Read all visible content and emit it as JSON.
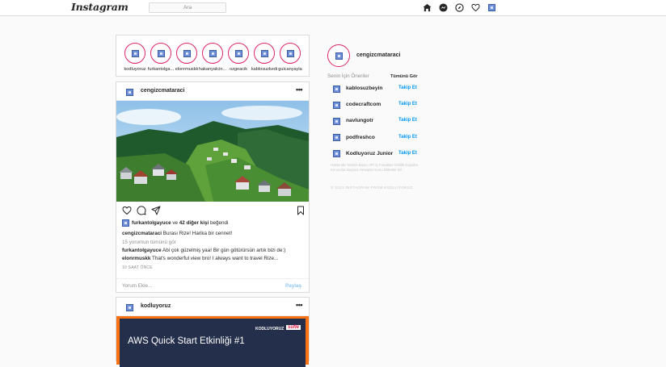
{
  "nav": {
    "logo": "Instagram",
    "search_placeholder": "Ara",
    "icons": [
      "home-icon",
      "messenger-icon",
      "explore-icon",
      "heart-icon",
      "profile-avatar"
    ]
  },
  "stories": [
    {
      "name": "kodluyoruz"
    },
    {
      "name": "furkantolga..."
    },
    {
      "name": "elonrmuskk"
    },
    {
      "name": "hakanyalcin..."
    },
    {
      "name": "ozgeacik"
    },
    {
      "name": "kablosuzkedi"
    },
    {
      "name": "guicanyayla"
    }
  ],
  "post": {
    "user": "cengizcmataraci",
    "more": "•••",
    "likes": {
      "first": "furkantolgayuce",
      "middle": " ve ",
      "others": "42 diğer kişi",
      "suffix": " beğendi"
    },
    "caption": {
      "user": "cengizcmataraci",
      "text": " Burası Rize! Harika bir cennet!"
    },
    "view_all": "15 yorumun tümünü gör",
    "comments": [
      {
        "user": "furkantolgayuce",
        "text": " Abi çok güzelmiş yaa! Bir gün götürürsün artık bizi de:)"
      },
      {
        "user": "elonrmuskk",
        "text": " That's wonderful view bro! I always want to travel Rize..."
      }
    ],
    "time": "10 SAAT ÖNCE",
    "add_comment_placeholder": "Yorum Ekle...",
    "share": "Paylaş"
  },
  "post2": {
    "user": "kodluyoruz",
    "more": "•••",
    "banner_title": "AWS Quick Start Etkinliği #1",
    "brand1": "KODLUYORUZ",
    "brand2": "sufle"
  },
  "sidebar": {
    "me": "cengizcmataraci",
    "suggestions_title": "Senin İçin Öneriler",
    "see_all": "Tümünü Gör",
    "follow_label": "Takip Et",
    "suggestions": [
      {
        "name": "kablosuzbeyin"
      },
      {
        "name": "codecraftcom"
      },
      {
        "name": "navlungotr"
      },
      {
        "name": "podfreshco"
      },
      {
        "name": "Kodluyoruz Junior"
      }
    ],
    "footer_links": "Hakkında Yardım Basın API İş Fırsatları Gizlilik Koşullar Konumlar Başlıca Hesaplar Konu Etiketler Dil",
    "copyright": "© 2021 INSTAGRAM FROM KODLUYORUZ"
  },
  "colors": {
    "story_ring": "#e0245e",
    "follow": "#0095f6"
  }
}
